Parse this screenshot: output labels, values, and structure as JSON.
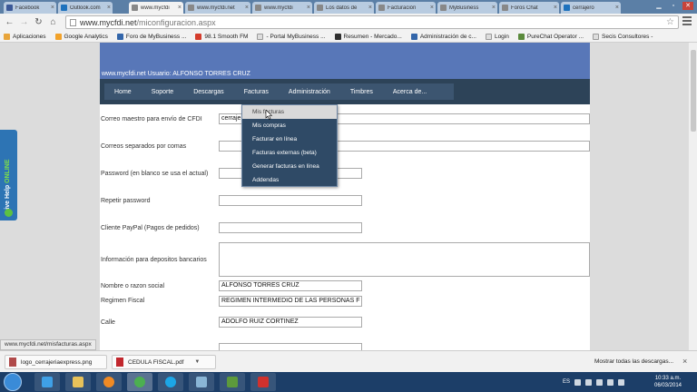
{
  "browser": {
    "tabs": [
      {
        "title": "Facebook",
        "icon_color": "#3b5998"
      },
      {
        "title": "Outlook.com",
        "icon_color": "#1e72bd"
      },
      {
        "title": "www.mycfdi",
        "icon_color": "#888888",
        "active": true
      },
      {
        "title": "www.mycfdi.net",
        "icon_color": "#888888"
      },
      {
        "title": "www.mycfdi",
        "icon_color": "#888888"
      },
      {
        "title": "Los datos de",
        "icon_color": "#888888"
      },
      {
        "title": "Facturación",
        "icon_color": "#888888"
      },
      {
        "title": "MyBusiness",
        "icon_color": "#888888"
      },
      {
        "title": "Foros Chat",
        "icon_color": "#888888"
      },
      {
        "title": "cerrajero",
        "icon_color": "#1e72bd"
      }
    ],
    "url_host": "www.mycfdi.net",
    "url_path": "/miconfiguracion.aspx",
    "bookmarks": [
      {
        "label": "Aplicaciones",
        "icon_color": "#e8a53b"
      },
      {
        "label": "Google Analytics",
        "icon_color": "#f2a22a"
      },
      {
        "label": "Foro de MyBusiness ...",
        "icon_color": "#3366aa"
      },
      {
        "label": "98.1 Smooth FM",
        "icon_color": "#d43c2c"
      },
      {
        "label": "- Portal MyBusiness ...",
        "icon_color": "#dddddd"
      },
      {
        "label": "Resumen - Mercado...",
        "icon_color": "#2f2f2f"
      },
      {
        "label": "Administración de c...",
        "icon_color": "#3366aa"
      },
      {
        "label": "Login",
        "icon_color": "#dddddd"
      },
      {
        "label": "PureChat Operator ...",
        "icon_color": "#5a8a3c"
      },
      {
        "label": "Secis Consultores -",
        "icon_color": "#dddddd"
      }
    ],
    "status_url": "www.mycfdi.net/misfacturas.aspx"
  },
  "site": {
    "user_line": "www.mycfdi.net Usuario: ALFONSO TORRES CRUZ",
    "nav": [
      "Home",
      "Soporte",
      "Descargas",
      "Facturas",
      "Administración",
      "Timbres",
      "Acerca de..."
    ],
    "dropdown": [
      "Mis facturas",
      "Mis compras",
      "Facturar en línea",
      "Facturas externas (beta)",
      "Generar facturas en línea",
      "Addendas"
    ],
    "form": {
      "correo_maestro_label": "Correo maestro para envío de CFDI",
      "correo_maestro_value": "cerraje",
      "correos_label": "Correos separados por comas",
      "password_label": "Password (en blanco se usa el actual)",
      "repetir_label": "Repetir password",
      "paypal_label": "Cliente PayPal (Pagos de pedidos)",
      "deposito_label": "Información para depositos bancarios",
      "razon_label": "Nombre o razon social",
      "razon_value": "ALFONSO TORRES CRUZ",
      "regimen_label": "Regimen Fiscal",
      "regimen_value": "REGIMEN INTERMEDIO DE LAS PERSONAS F",
      "calle_label": "Calle",
      "calle_value": "ADOLFO RUIZ CORTINEZ"
    }
  },
  "livehelp": {
    "label": "Live Help",
    "status": "ONLINE"
  },
  "downloads": {
    "items": [
      {
        "name": "logo_cerrajeriaexpress.png",
        "icon_color": "#b04a4a"
      },
      {
        "name": "CEDULA FISCAL.pdf",
        "icon_color": "#c1272d"
      }
    ],
    "show_all": "Mostrar todas las descargas...",
    "close": "×"
  },
  "taskbar": {
    "language": "ES",
    "time": "10:33 a.m.",
    "date": "06/03/2014",
    "apps": [
      {
        "name": "ie-icon",
        "color": "#3fa0e6"
      },
      {
        "name": "explorer-icon",
        "color": "#e8c25a"
      },
      {
        "name": "media-player-icon",
        "color": "#f08a24"
      },
      {
        "name": "chrome-icon",
        "color": "#4caf50",
        "active": true
      },
      {
        "name": "skype-icon",
        "color": "#1ca6e6"
      },
      {
        "name": "network-icon",
        "color": "#8ab6d6"
      },
      {
        "name": "app-icon",
        "color": "#5d9a3c"
      },
      {
        "name": "acrobat-icon",
        "color": "#d0312d"
      }
    ]
  }
}
